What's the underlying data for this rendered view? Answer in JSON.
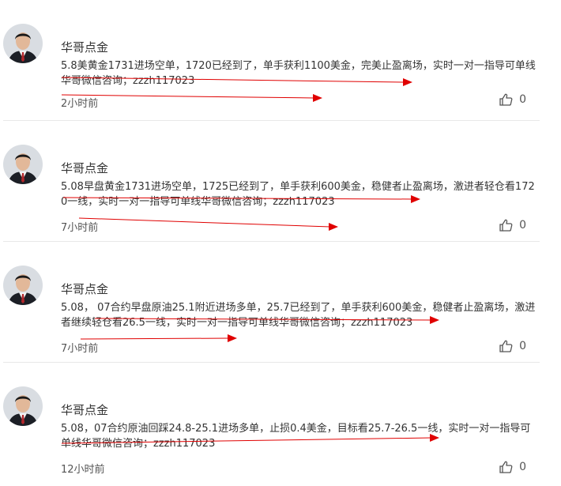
{
  "comments": [
    {
      "author": "华哥点金",
      "content": "5.8美黄金1731进场空单，1720已经到了，单手获利1100美金，完美止盈离场，实时一对一指导可单线华哥微信咨询；zzzh117023",
      "time": "2小时前",
      "likes": "0"
    },
    {
      "author": "华哥点金",
      "content": "5.08早盘黄金1731进场空单，1725已经到了，单手获利600美金，稳健者止盈离场，激进者轻仓看1720一线，实时一对一指导可单线华哥微信咨询；zzzh117023",
      "time": "7小时前",
      "likes": "0"
    },
    {
      "author": "华哥点金",
      "content": "5.08， 07合约早盘原油25.1附近进场多单，25.7已经到了，单手获利600美金，稳健者止盈离场，激进者继续轻仓看26.5一线，实时一对一指导可单线华哥微信咨询；zzzh117023",
      "time": "7小时前",
      "likes": "0"
    },
    {
      "author": "华哥点金",
      "content": "5.08，07合约原油回踩24.8-25.1进场多单，止损0.4美金，目标看25.7-26.5一线，实时一对一指导可单线华哥微信咨询；zzzh117023",
      "time": "12小时前",
      "likes": "0"
    }
  ],
  "colors": {
    "annotation_arrow": "#e00000",
    "divider": "#e8e8e8",
    "like_icon": "#555555"
  },
  "icons": {
    "like": "thumbs-up-icon",
    "avatar": "avatar-photo"
  }
}
